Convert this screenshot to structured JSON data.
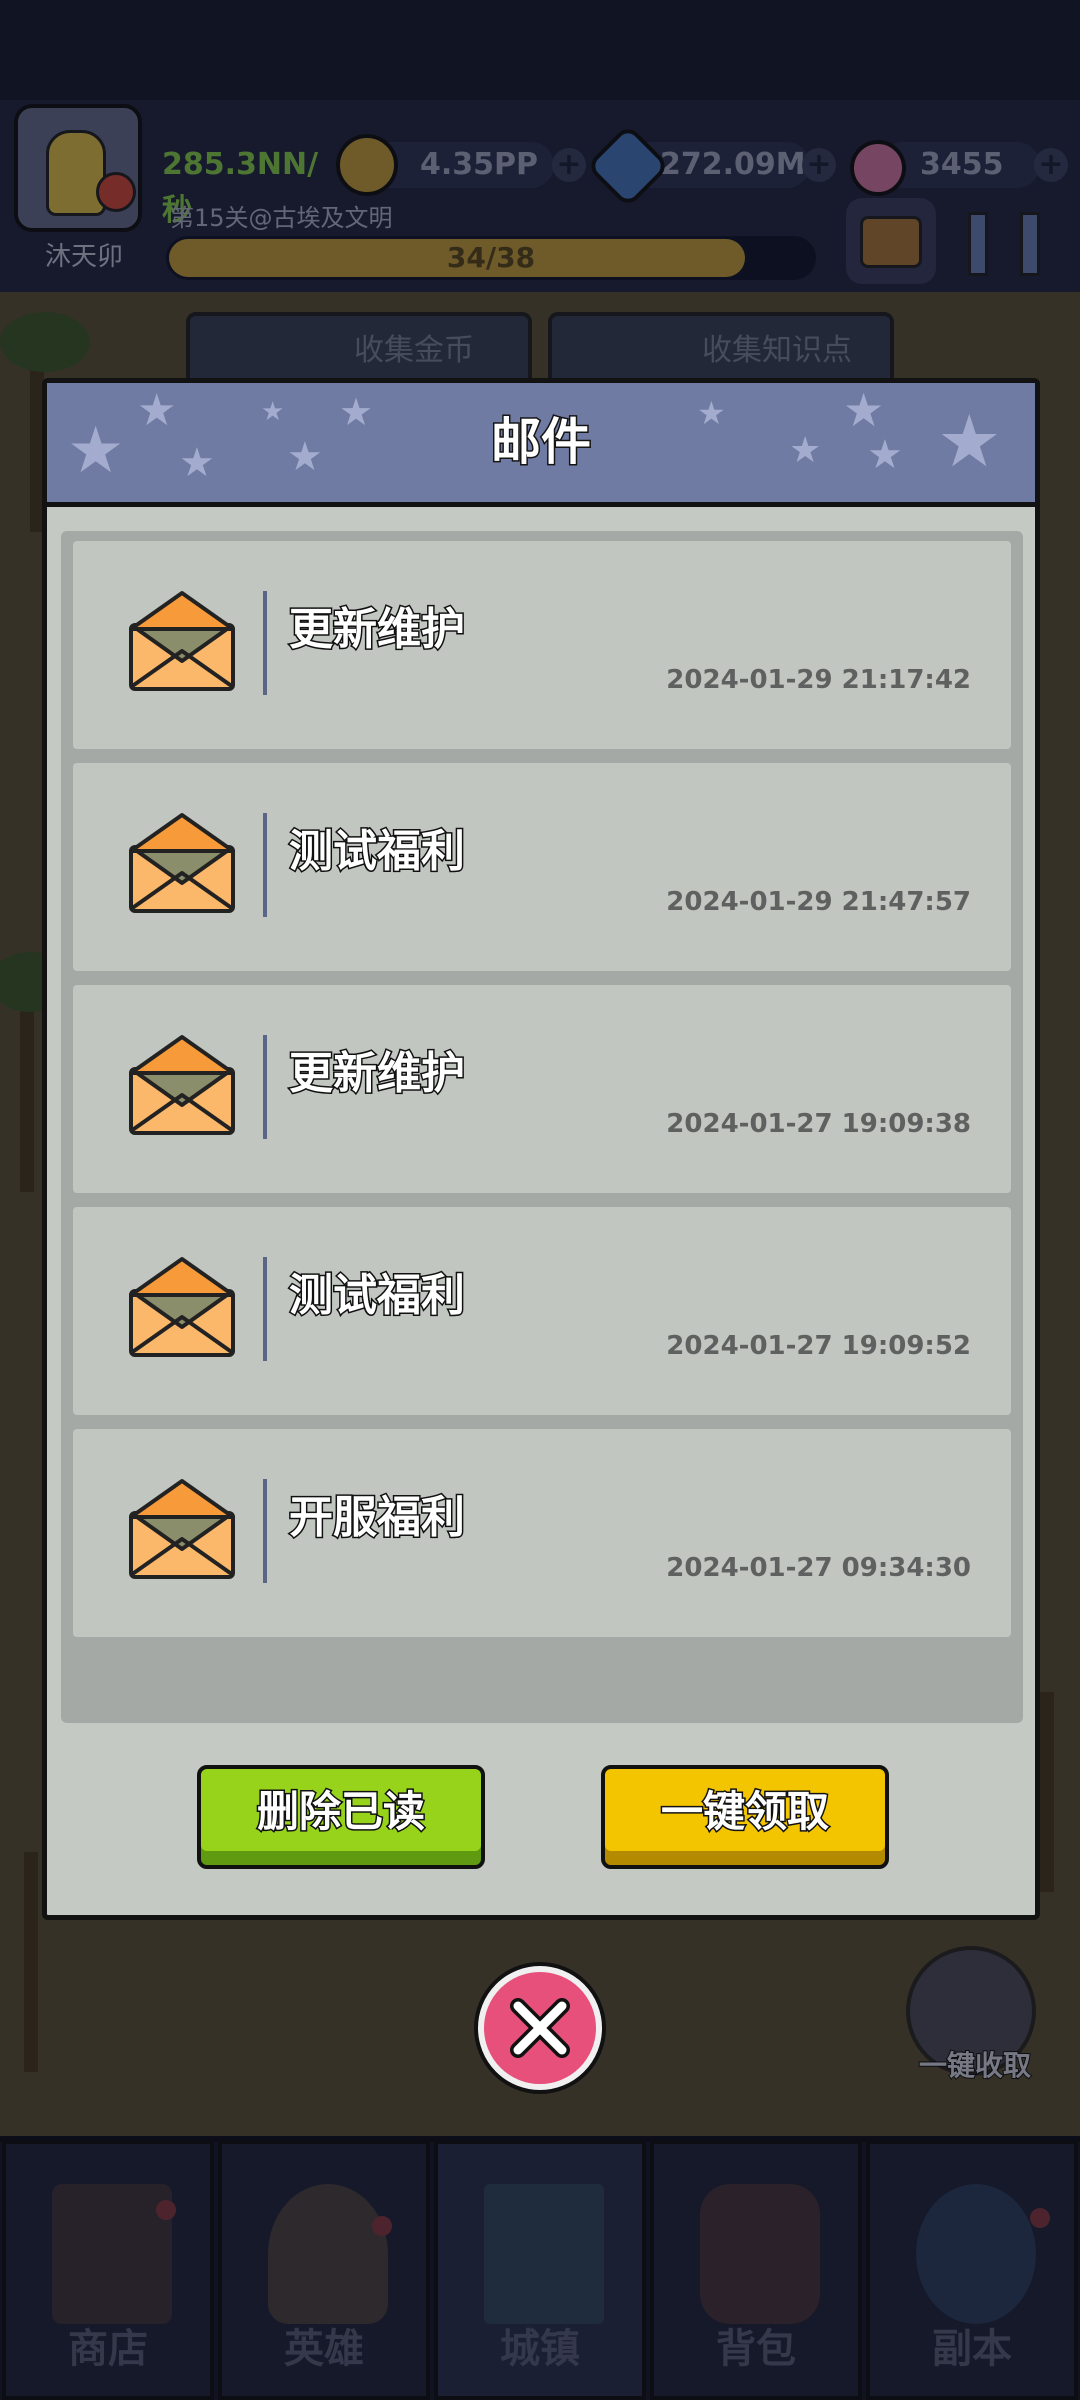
{
  "player": {
    "name": "沐天卯",
    "income_rate": "285.3NN/秒",
    "level_text": "第15关@古埃及文明",
    "progress_text": "34/38",
    "progress_fraction": 0.8947
  },
  "resources": {
    "crowns": "4.35PP",
    "knowledge": "272.09M",
    "gems": "3455"
  },
  "top_tabs": {
    "collect_gold": "收集金币",
    "collect_knowledge": "收集知识点"
  },
  "dialog": {
    "title": "邮件",
    "mails": [
      {
        "subject": "更新维护",
        "time": "2024-01-29 21:17:42"
      },
      {
        "subject": "测试福利",
        "time": "2024-01-29 21:47:57"
      },
      {
        "subject": "更新维护",
        "time": "2024-01-27 19:09:38"
      },
      {
        "subject": "测试福利",
        "time": "2024-01-27 19:09:52"
      },
      {
        "subject": "开服福利",
        "time": "2024-01-27 09:34:30"
      }
    ],
    "delete_read_label": "删除已读",
    "claim_all_label": "一键领取"
  },
  "collect_all_label": "一键收取",
  "bottom_nav": {
    "shop": "商店",
    "heroes": "英雄",
    "town": "城镇",
    "backpack": "背包",
    "dungeon": "副本"
  },
  "colors": {
    "header_bg": "#6f7ba2",
    "panel_bg": "#c4c9c4",
    "delete_button": "#98d31c",
    "claim_button": "#f3c400",
    "close_button": "#e6507a",
    "envelope_orange": "#f79a3a"
  }
}
